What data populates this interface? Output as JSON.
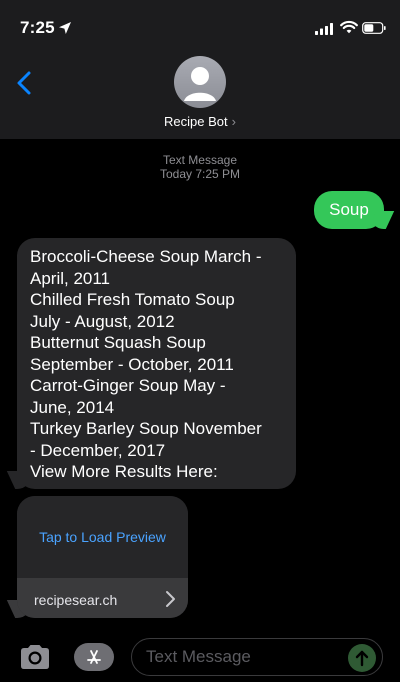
{
  "status_bar": {
    "time": "7:25"
  },
  "header": {
    "contact_name": "Recipe Bot",
    "contact_chevron": "›"
  },
  "conversation": {
    "meta_line_1": "Text Message",
    "meta_line_2": "Today 7:25 PM",
    "outgoing": {
      "text": "Soup",
      "color": "#34c759"
    },
    "incoming": {
      "lines": [
        "Broccoli-Cheese Soup March -",
        "April, 2011",
        "Chilled Fresh Tomato Soup",
        "July - August, 2012",
        "Butternut Squash Soup",
        "September - October, 2011",
        "Carrot-Ginger Soup May -",
        "June, 2014",
        "Turkey Barley Soup November",
        "- December, 2017",
        "View More Results Here:"
      ]
    },
    "link_preview": {
      "tap_text": "Tap to Load Preview",
      "domain": "recipesear.ch",
      "accent": "#4aa3ff"
    }
  },
  "input_bar": {
    "placeholder": "Text Message",
    "send_color": "#2f5a34"
  },
  "icons": {
    "back": "chevron-left-icon",
    "location": "location-arrow-icon",
    "signal": "cellular-signal-icon",
    "wifi": "wifi-icon",
    "battery": "battery-icon",
    "avatar": "person-icon",
    "camera": "camera-icon",
    "app_store": "app-store-icon",
    "send": "arrow-up-icon"
  }
}
